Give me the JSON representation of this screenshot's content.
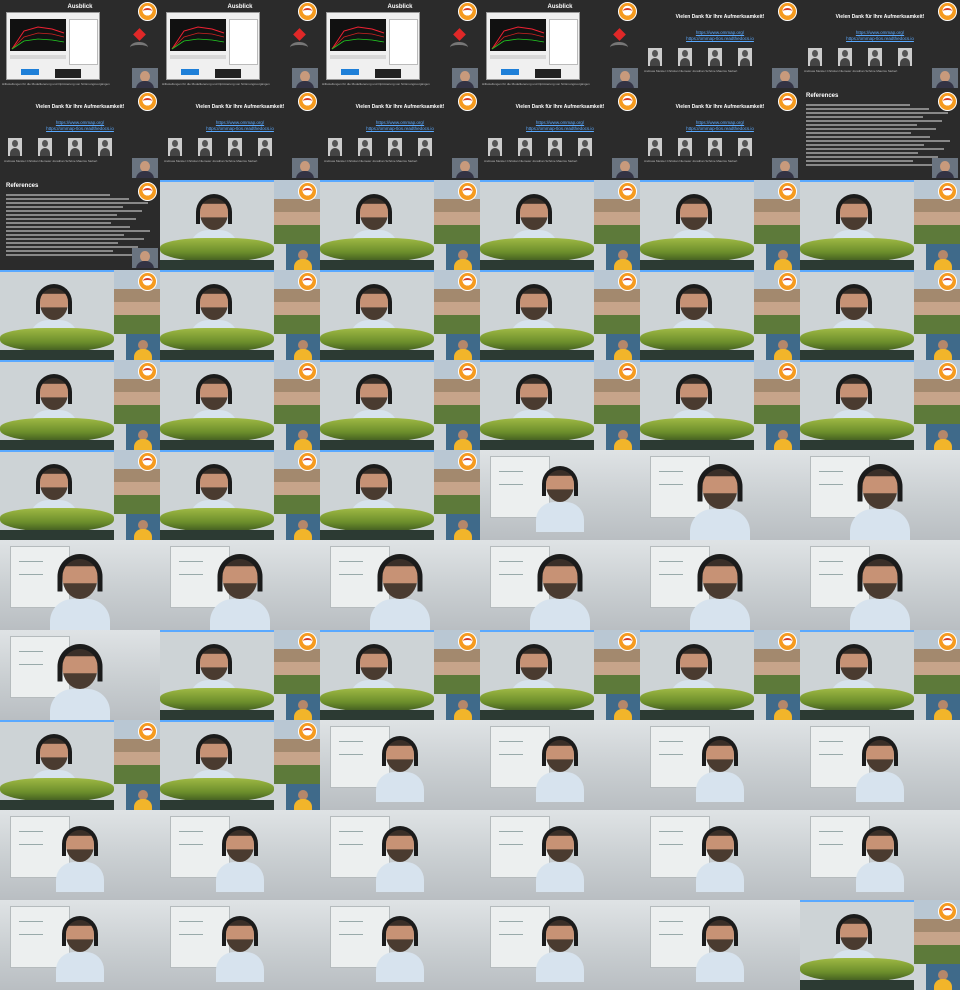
{
  "slides": {
    "ausblick": {
      "title": "Ausblick",
      "caption": "Hilfestellungen für die Modelliererung und Optimierung von Strömungsvorgängen"
    },
    "thanks": {
      "title": "Vielen Dank für Ihre Aufmerksamkeit!",
      "url1": "https://www.ommap.org/",
      "url2": "https://ommap-tlos.readthedocs.io",
      "caption": "Andreas Meister   Christian Niemeier   Jonathan Schöne   Maurice Siebert"
    },
    "references": {
      "title": "References"
    }
  },
  "frames": [
    {
      "kind": "ausblick"
    },
    {
      "kind": "ausblick"
    },
    {
      "kind": "ausblick"
    },
    {
      "kind": "ausblick"
    },
    {
      "kind": "thanks"
    },
    {
      "kind": "thanks"
    },
    {
      "kind": "thanks"
    },
    {
      "kind": "thanks"
    },
    {
      "kind": "thanks"
    },
    {
      "kind": "thanks"
    },
    {
      "kind": "thanks"
    },
    {
      "kind": "references"
    },
    {
      "kind": "references"
    },
    {
      "kind": "comp"
    },
    {
      "kind": "comp"
    },
    {
      "kind": "comp"
    },
    {
      "kind": "comp"
    },
    {
      "kind": "comp"
    },
    {
      "kind": "comp"
    },
    {
      "kind": "comp"
    },
    {
      "kind": "comp"
    },
    {
      "kind": "comp"
    },
    {
      "kind": "comp"
    },
    {
      "kind": "comp"
    },
    {
      "kind": "comp"
    },
    {
      "kind": "comp"
    },
    {
      "kind": "comp"
    },
    {
      "kind": "comp"
    },
    {
      "kind": "comp"
    },
    {
      "kind": "comp"
    },
    {
      "kind": "comp"
    },
    {
      "kind": "comp"
    },
    {
      "kind": "comp"
    },
    {
      "kind": "cam"
    },
    {
      "kind": "cam"
    },
    {
      "kind": "cam"
    },
    {
      "kind": "cam"
    },
    {
      "kind": "cam"
    },
    {
      "kind": "cam"
    },
    {
      "kind": "cam"
    },
    {
      "kind": "cam"
    },
    {
      "kind": "cam"
    },
    {
      "kind": "cam"
    },
    {
      "kind": "comp"
    },
    {
      "kind": "comp"
    },
    {
      "kind": "comp"
    },
    {
      "kind": "comp"
    },
    {
      "kind": "comp"
    },
    {
      "kind": "comp"
    },
    {
      "kind": "comp"
    },
    {
      "kind": "cam"
    },
    {
      "kind": "cam"
    },
    {
      "kind": "cam"
    },
    {
      "kind": "cam"
    },
    {
      "kind": "cam"
    },
    {
      "kind": "cam"
    },
    {
      "kind": "cam"
    },
    {
      "kind": "cam"
    },
    {
      "kind": "cam"
    },
    {
      "kind": "cam"
    },
    {
      "kind": "cam"
    },
    {
      "kind": "cam"
    },
    {
      "kind": "cam"
    },
    {
      "kind": "cam"
    },
    {
      "kind": "cam"
    },
    {
      "kind": "comp"
    }
  ]
}
